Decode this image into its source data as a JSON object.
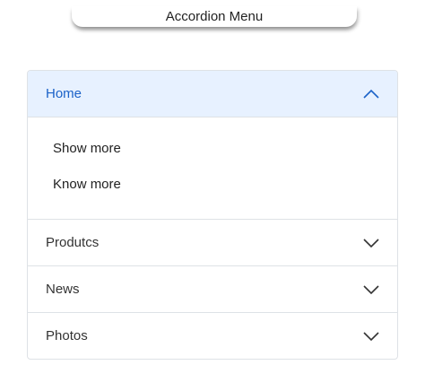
{
  "page": {
    "title": "Accordion Menu"
  },
  "accordion": {
    "items": [
      {
        "label": "Home",
        "expanded": true,
        "icon": "chevron-up-icon",
        "children": [
          "Show more",
          "Know more"
        ]
      },
      {
        "label": "Produtcs",
        "expanded": false,
        "icon": "chevron-down-icon"
      },
      {
        "label": "News",
        "expanded": false,
        "icon": "chevron-down-icon"
      },
      {
        "label": "Photos",
        "expanded": false,
        "icon": "chevron-down-icon"
      }
    ]
  },
  "colors": {
    "active_bg": "#e7f1ff",
    "active_text": "#1b62c8",
    "border": "#dee2e6"
  }
}
